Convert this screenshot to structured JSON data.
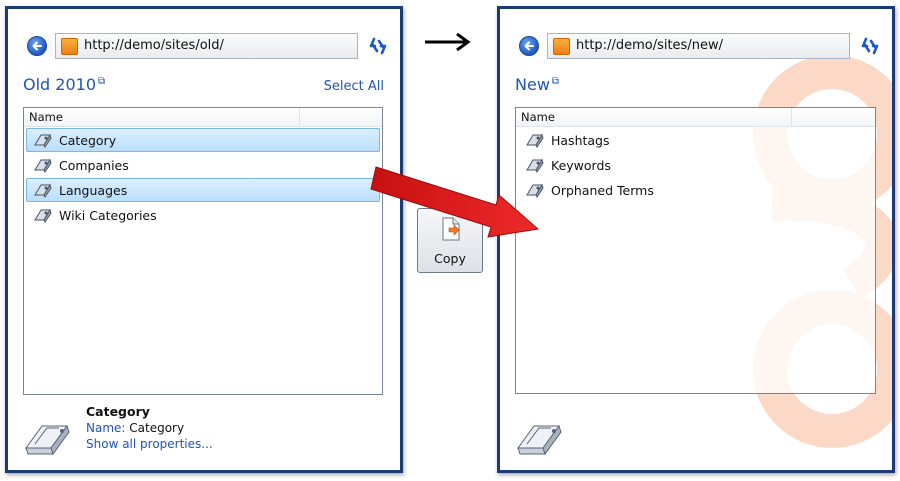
{
  "left_panel": {
    "url": "http://demo/sites/old/",
    "title": "Old 2010",
    "select_all": "Select All",
    "column_header": "Name",
    "items": [
      {
        "label": "Category",
        "selected": true
      },
      {
        "label": "Companies",
        "selected": false
      },
      {
        "label": "Languages",
        "selected": true
      },
      {
        "label": "Wiki Categories",
        "selected": false
      }
    ],
    "details": {
      "title": "Category",
      "name_label": "Name:",
      "name_value": "Category",
      "link": "Show all properties..."
    }
  },
  "right_panel": {
    "url": "http://demo/sites/new/",
    "title": "New",
    "column_header": "Name",
    "items": [
      {
        "label": "Hashtags"
      },
      {
        "label": "Keywords"
      },
      {
        "label": "Orphaned Terms"
      }
    ]
  },
  "copy_button": {
    "label": "Copy"
  },
  "colors": {
    "accent": "#1e55b8",
    "frame": "#1c3a74",
    "selection": "#b9defc",
    "red_arrow": "#e31d1d",
    "watermark": "#fbd9c6"
  },
  "icons": [
    "back-arrow-icon",
    "site-icon",
    "refresh-icon",
    "external-link-icon",
    "term-set-icon",
    "term-store-icon",
    "copy-document-icon"
  ]
}
